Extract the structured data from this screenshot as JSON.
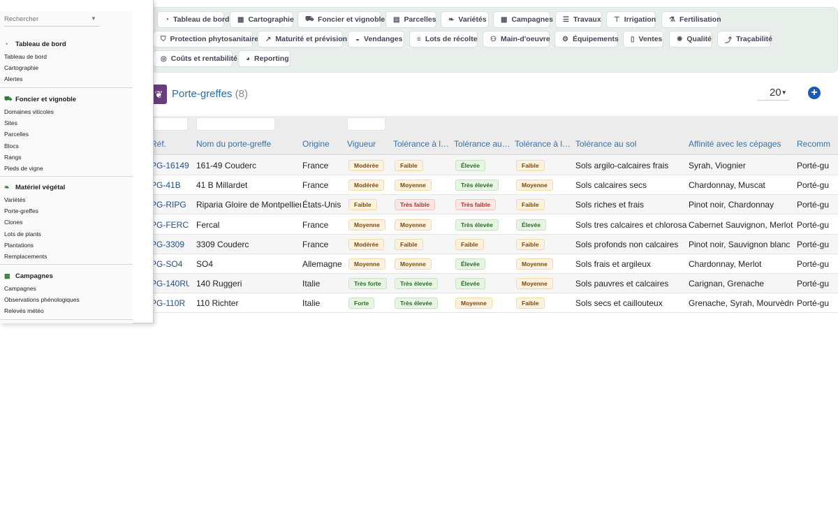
{
  "search": {
    "placeholder": "Rechercher"
  },
  "nav_tabs": [
    {
      "label": "Tableau de bord",
      "icon": "dashboard-icon"
    },
    {
      "label": "Cartographie",
      "icon": "map-icon"
    },
    {
      "label": "Foncier et vignoble",
      "icon": "tractor-icon"
    },
    {
      "label": "Parcelles",
      "icon": "parcel-map-icon"
    },
    {
      "label": "Variétés",
      "icon": "leaf-icon"
    },
    {
      "label": "Campagnes",
      "icon": "calendar-icon"
    },
    {
      "label": "Travaux",
      "icon": "list-icon"
    },
    {
      "label": "Irrigation",
      "icon": "faucet-icon"
    },
    {
      "label": "Fertilisation",
      "icon": "flask-icon"
    },
    {
      "label": "Protection phytosanitaire",
      "icon": "shield-icon"
    },
    {
      "label": "Maturité et prévision",
      "icon": "chart-icon"
    },
    {
      "label": "Vendanges",
      "icon": "basket-icon"
    },
    {
      "label": "Lots de récolte",
      "icon": "barcode-icon"
    },
    {
      "label": "Main-d'oeuvre",
      "icon": "users-icon"
    },
    {
      "label": "Équipements",
      "icon": "tools-icon"
    },
    {
      "label": "Ventes",
      "icon": "receipt-icon"
    },
    {
      "label": "Qualité",
      "icon": "certificate-icon"
    },
    {
      "label": "Traçabilité",
      "icon": "route-icon"
    },
    {
      "label": "Coûts et rentabilité",
      "icon": "coins-icon"
    },
    {
      "label": "Reporting",
      "icon": "pie-chart-icon"
    }
  ],
  "sidebar": [
    {
      "title": "Tableau de bord",
      "icon": "dashboard-icon",
      "items": [
        "Tableau de bord",
        "Cartographie",
        "Alertes"
      ]
    },
    {
      "title": "Foncier et vignoble",
      "icon": "tractor-icon",
      "items": [
        "Domaines viticoles",
        "Sites",
        "Parcelles",
        "Blocs",
        "Rangs",
        "Pieds de vigne"
      ]
    },
    {
      "title": "Matériel végétal",
      "icon": "leaf-icon",
      "items": [
        "Variétés",
        "Porte-greffes",
        "Clones",
        "Lots de plants",
        "Plantations",
        "Remplacements"
      ]
    },
    {
      "title": "Campagnes",
      "icon": "calendar-icon",
      "items": [
        "Campagnes",
        "Observations phénologiques",
        "Relevés météo"
      ]
    }
  ],
  "header": {
    "title": "Porte-greffes",
    "count": "(8)",
    "page_size": "20",
    "add_icon": "add-circle-icon"
  },
  "columns": [
    "Réf.",
    "Nom du porte-greffe",
    "Origine",
    "Vigueur",
    "Tolérance à l…",
    "Tolérance au…",
    "Tolérance à l…",
    "Tolérance au sol",
    "Affinité avec les cépages",
    "Recomm"
  ],
  "rows": [
    {
      "ref": "PG-16149",
      "name": "161-49 Couderc",
      "origin": "France",
      "vigueur": "Modérée",
      "t1": "Faible",
      "t2": "Élevée",
      "t3": "Faible",
      "sol": "Sols argilo-calcaires frais",
      "affinite": "Syrah, Viognier",
      "recom": "Porté-gu"
    },
    {
      "ref": "PG-41B",
      "name": "41 B Millardet",
      "origin": "France",
      "vigueur": "Modérée",
      "t1": "Moyenne",
      "t2": "Très élevée",
      "t3": "Moyenne",
      "sol": "Sols calcaires secs",
      "affinite": "Chardonnay, Muscat",
      "recom": "Porté-gu"
    },
    {
      "ref": "PG-RIPG",
      "name": "Riparia Gloire de Montpellier",
      "origin": "États-Unis",
      "vigueur": "Faible",
      "t1": "Très faible",
      "t2": "Très faible",
      "t3": "Faible",
      "sol": "Sols riches et frais",
      "affinite": "Pinot noir, Chardonnay",
      "recom": "Porté-gu"
    },
    {
      "ref": "PG-FERC",
      "name": "Fercal",
      "origin": "France",
      "vigueur": "Moyenne",
      "t1": "Moyenne",
      "t2": "Très élevée",
      "t3": "Élevée",
      "sol": "Sols tres calcaires et chlorosants",
      "affinite": "Cabernet Sauvignon, Merlot",
      "recom": "Porté-gu"
    },
    {
      "ref": "PG-3309",
      "name": "3309 Couderc",
      "origin": "France",
      "vigueur": "Modérée",
      "t1": "Faible",
      "t2": "Faible",
      "t3": "Faible",
      "sol": "Sols profonds non calcaires",
      "affinite": "Pinot noir, Sauvignon blanc",
      "recom": "Porté-gu"
    },
    {
      "ref": "PG-SO4",
      "name": "SO4",
      "origin": "Allemagne",
      "vigueur": "Moyenne",
      "t1": "Moyenne",
      "t2": "Élevée",
      "t3": "Moyenne",
      "sol": "Sols frais et argileux",
      "affinite": "Chardonnay, Merlot",
      "recom": "Porté-gu"
    },
    {
      "ref": "PG-140RU",
      "name": "140 Ruggeri",
      "origin": "Italie",
      "vigueur": "Très forte",
      "t1": "Très élevée",
      "t2": "Élevée",
      "t3": "Moyenne",
      "sol": "Sols pauvres et calcaires",
      "affinite": "Carignan, Grenache",
      "recom": "Porté-gu"
    },
    {
      "ref": "PG-110R",
      "name": "110 Richter",
      "origin": "Italie",
      "vigueur": "Forte",
      "t1": "Très élevée",
      "t2": "Moyenne",
      "t3": "Faible",
      "sol": "Sols secs et caillouteux",
      "affinite": "Grenache, Syrah, Mourvèdre",
      "recom": "Porté-gu"
    }
  ]
}
